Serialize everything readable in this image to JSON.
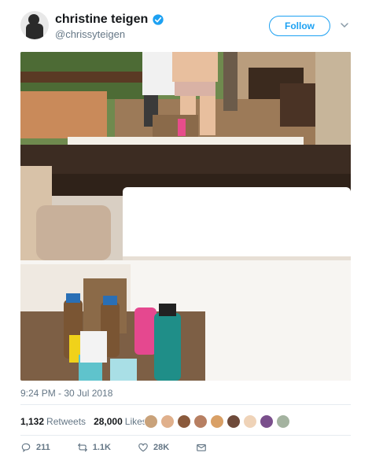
{
  "user": {
    "display_name": "christine teigen",
    "handle": "@chrissyteigen",
    "verified": true
  },
  "header": {
    "follow_label": "Follow",
    "caret_icon": "chevron-down-icon"
  },
  "photo": {
    "subject": "resort-cabana-photo"
  },
  "tweet": {
    "timestamp": "9:24 PM - 30 Jul 2018"
  },
  "stats": {
    "retweets_count": "1,132",
    "retweets_label": "Retweets",
    "likes_count": "28,000",
    "likes_label": "Likes",
    "liker_colors": [
      "#c9a27a",
      "#e0b08c",
      "#8a5a3c",
      "#b77f62",
      "#d9a066",
      "#6e4a3a",
      "#efd3b8",
      "#7a4f8c",
      "#a4b3a0"
    ]
  },
  "actions": {
    "replies": "211",
    "retweets": "1.1K",
    "likes": "28K"
  },
  "colors": {
    "accent": "#1da1f2",
    "secondary_text": "#657786",
    "divider": "#e6ecf0"
  }
}
